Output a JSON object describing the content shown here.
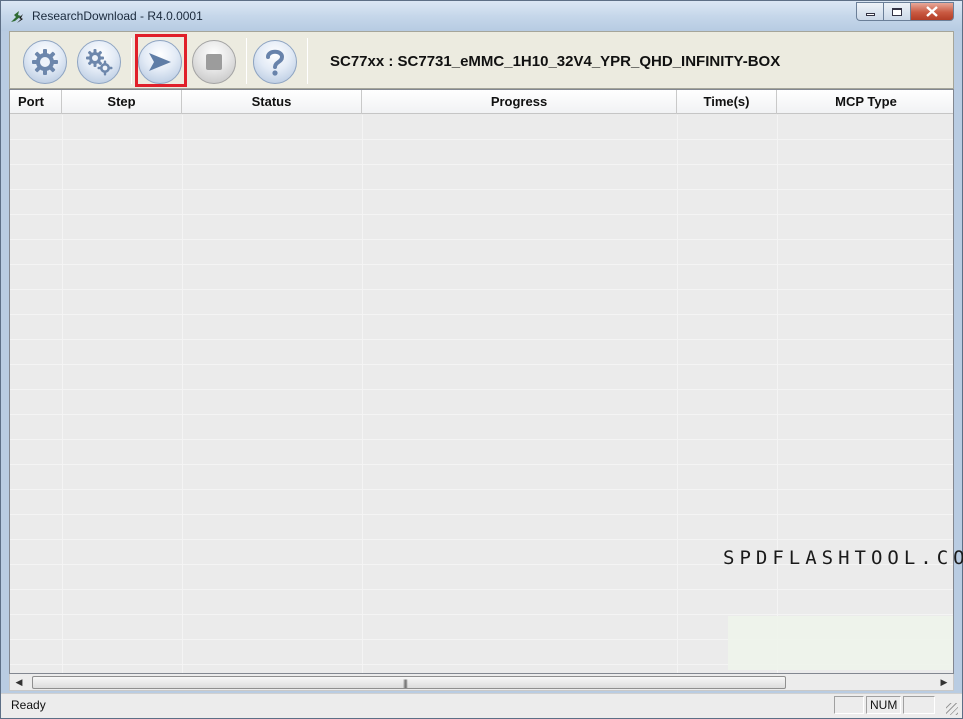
{
  "window": {
    "title": "ResearchDownload - R4.0.0001"
  },
  "toolbar": {
    "buttons": [
      {
        "id": "load-packet",
        "icon": "gear-icon"
      },
      {
        "id": "settings",
        "icon": "gears-icon"
      },
      {
        "id": "start-download",
        "icon": "play-arrow-icon",
        "highlighted": true
      },
      {
        "id": "stop-download",
        "icon": "stop-icon",
        "enabled": false
      },
      {
        "id": "help",
        "icon": "help-icon"
      }
    ],
    "device_label": "SC77xx : SC7731_eMMC_1H10_32V4_YPR_QHD_INFINITY-BOX",
    "highlight_color": "#e0202a"
  },
  "list": {
    "columns": [
      "Port",
      "Step",
      "Status",
      "Progress",
      "Time(s)",
      "MCP Type"
    ],
    "rows": []
  },
  "watermark": "SPDFLASHTOOL.COM",
  "statusbar": {
    "text": "Ready",
    "num": "NUM"
  }
}
